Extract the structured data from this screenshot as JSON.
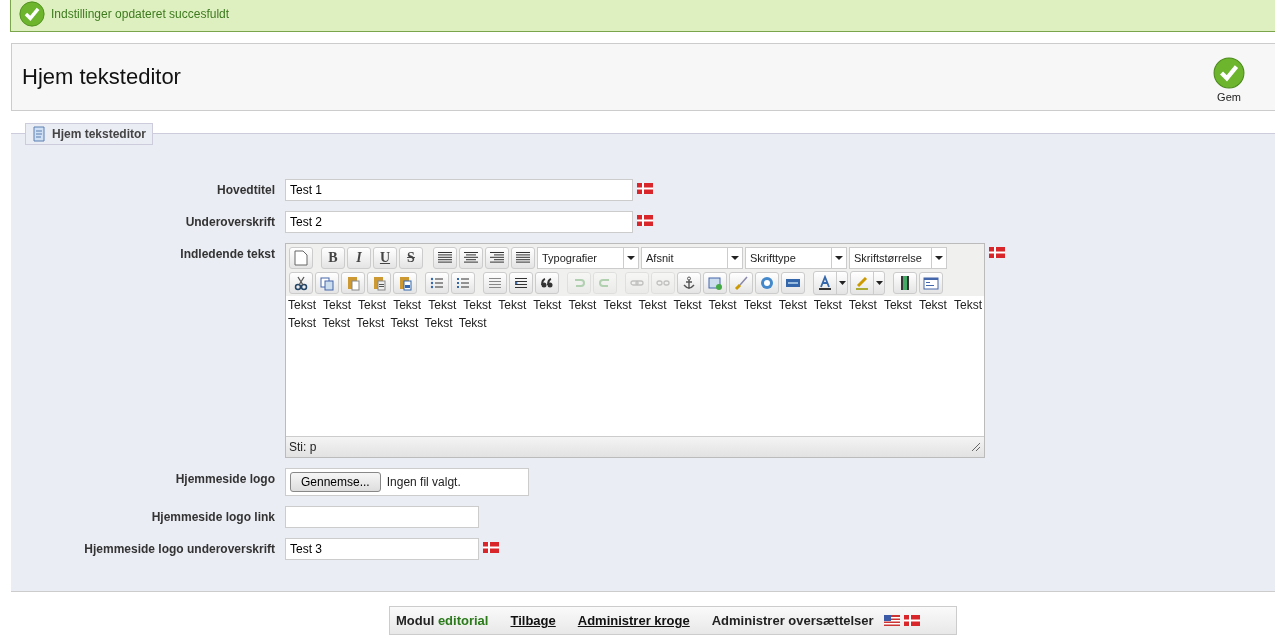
{
  "message": {
    "text": "Indstillinger opdateret succesfuldt"
  },
  "header": {
    "title": "Hjem teksteditor",
    "save_label": "Gem"
  },
  "panel": {
    "legend": "Hjem teksteditor"
  },
  "fields": [
    {
      "kind": "text",
      "label": "Hovedtitel",
      "value": "Test 1",
      "flag": true
    },
    {
      "kind": "text",
      "label": "Underoverskrift",
      "value": "Test 2",
      "flag": true
    },
    {
      "kind": "editor",
      "label": "Indledende tekst",
      "flag": true
    },
    {
      "kind": "file",
      "label": "Hjemmeside logo",
      "button": "Gennemse...",
      "status": "Ingen fil valgt.",
      "flag": false
    },
    {
      "kind": "short",
      "label": "Hjemmeside logo link",
      "flag": false
    },
    {
      "kind": "short",
      "label": "Hjemmeside logo underoverskrift",
      "value": "Test 3",
      "flag": true
    }
  ],
  "editor": {
    "format_buttons": [
      "B",
      "I",
      "U",
      "S"
    ],
    "selects": [
      "Typografier",
      "Afsnit",
      "Skrifttype",
      "Skriftstørrelse"
    ],
    "row2_disabled": [
      false,
      false,
      false,
      false,
      false,
      false,
      false,
      false,
      false,
      false,
      true,
      true,
      true,
      true,
      false,
      false,
      false,
      false,
      false,
      false,
      false,
      false,
      false
    ],
    "content": "Tekst Tekst Tekst Tekst Tekst Tekst Tekst Tekst Tekst Tekst Tekst Tekst Tekst Tekst Tekst Tekst Tekst Tekst Tekst Tekst Tekst Tekst Tekst Tekst Tekst Tekst",
    "path": "Sti: p"
  },
  "footer": {
    "module_label": "Modul",
    "module_name": "editorial",
    "links": [
      "Tilbage",
      "Administrer kroge"
    ],
    "translations": "Administrer oversættelser"
  }
}
